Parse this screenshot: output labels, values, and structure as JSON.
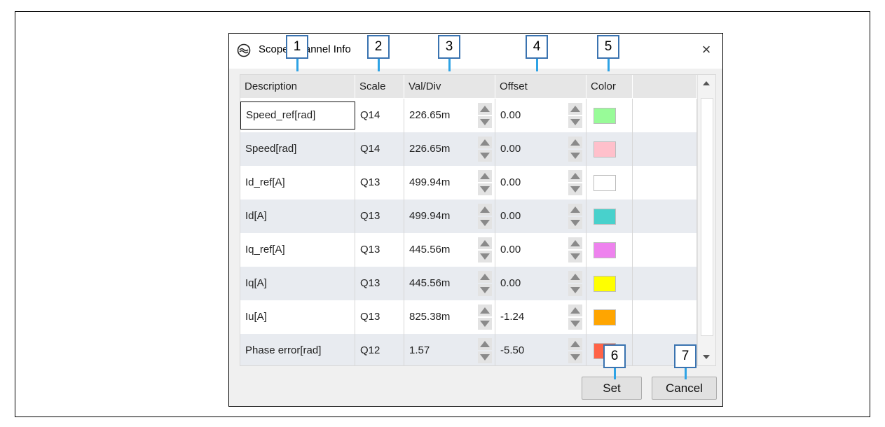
{
  "dialog": {
    "title": "Scope Channel Info",
    "close_glyph": "×"
  },
  "columns": [
    "Description",
    "Scale",
    "Val/Div",
    "Offset",
    "Color"
  ],
  "rows": [
    {
      "description": "Speed_ref[rad]",
      "scale": "Q14",
      "val_div": "226.65m",
      "offset": "0.00",
      "color": "#98fb98"
    },
    {
      "description": "Speed[rad]",
      "scale": "Q14",
      "val_div": "226.65m",
      "offset": "0.00",
      "color": "#ffc0cb"
    },
    {
      "description": "Id_ref[A]",
      "scale": "Q13",
      "val_div": "499.94m",
      "offset": "0.00",
      "color": "#ffffff"
    },
    {
      "description": "Id[A]",
      "scale": "Q13",
      "val_div": "499.94m",
      "offset": "0.00",
      "color": "#48d1cc"
    },
    {
      "description": "Iq_ref[A]",
      "scale": "Q13",
      "val_div": "445.56m",
      "offset": "0.00",
      "color": "#ee82ee"
    },
    {
      "description": "Iq[A]",
      "scale": "Q13",
      "val_div": "445.56m",
      "offset": "0.00",
      "color": "#ffff00"
    },
    {
      "description": "Iu[A]",
      "scale": "Q13",
      "val_div": "825.38m",
      "offset": "-1.24",
      "color": "#ffa500"
    },
    {
      "description": "Phase error[rad]",
      "scale": "Q12",
      "val_div": "1.57",
      "offset": "-5.50",
      "color": "#ff6347"
    }
  ],
  "buttons": {
    "set": "Set",
    "cancel": "Cancel"
  },
  "callouts": [
    "1",
    "2",
    "3",
    "4",
    "5",
    "6",
    "7"
  ],
  "accent_colors": {
    "callout_border": "#3a73b0",
    "callout_line": "#2ea3e5"
  }
}
